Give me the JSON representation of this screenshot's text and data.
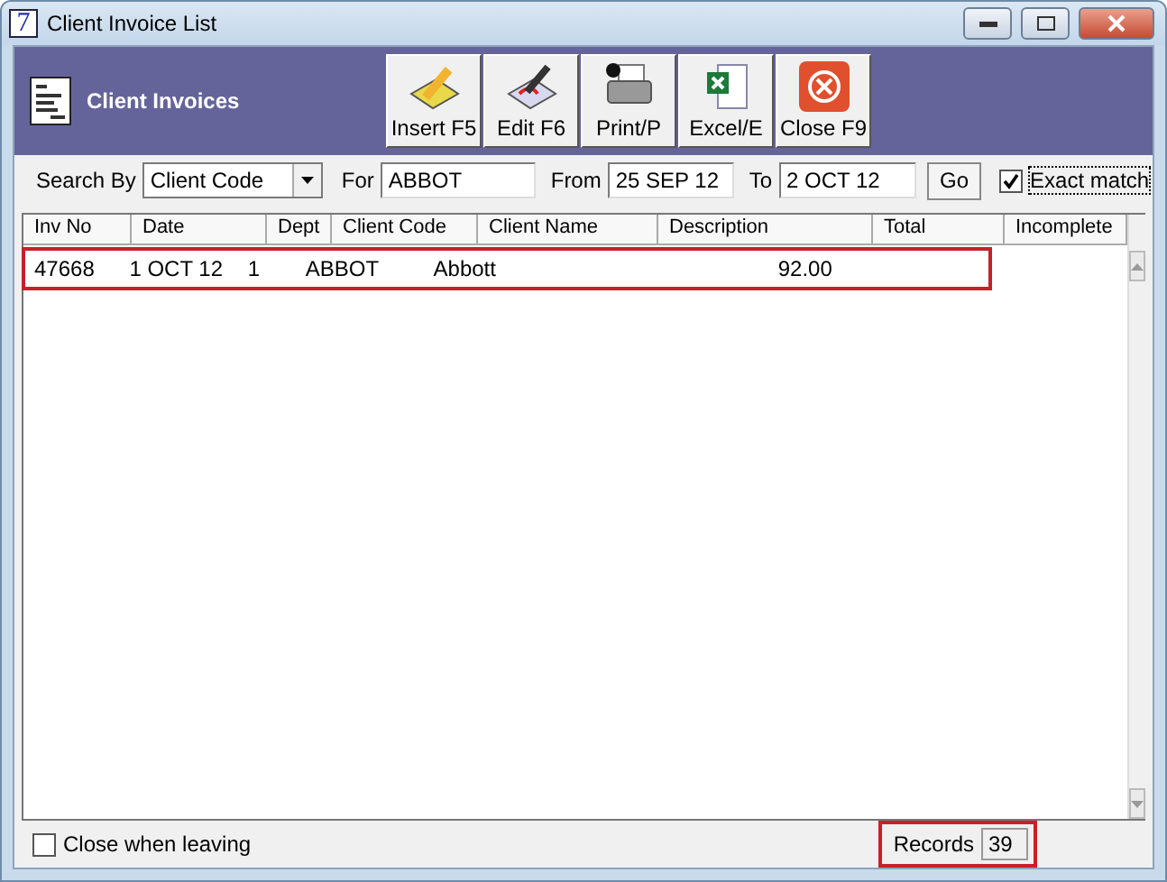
{
  "window": {
    "icon": "7",
    "title": "Client Invoice List"
  },
  "header": {
    "title": "Client Invoices"
  },
  "toolbar": [
    {
      "label": "Insert F5",
      "kind": "insert"
    },
    {
      "label": "Edit F6",
      "kind": "edit"
    },
    {
      "label": "Print/P",
      "kind": "print"
    },
    {
      "label": "Excel/E",
      "kind": "excel"
    },
    {
      "label": "Close F9",
      "kind": "close"
    }
  ],
  "search": {
    "search_by_label": "Search By",
    "search_by": "Client Code",
    "for_label": "For",
    "for": "ABBOT",
    "from_label": "From",
    "from": "25 SEP 12",
    "to_label": "To",
    "to": "2 OCT 12",
    "go": "Go",
    "exact_match": {
      "label": "Exact match",
      "checked": true
    }
  },
  "table": {
    "columns": [
      "Inv No",
      "Date",
      "Dept",
      "Client Code",
      "Client Name",
      "Description",
      "Total",
      "Incomplete"
    ],
    "rows": [
      {
        "cells": [
          "47668",
          "1 OCT 12",
          "1",
          "ABBOT",
          "Abbott",
          "",
          "92.00",
          ""
        ],
        "highlighted": true
      }
    ]
  },
  "footer": {
    "close_when_leaving": {
      "label": "Close when leaving",
      "checked": false
    },
    "records_label": "Records",
    "records": "39",
    "highlighted": true
  }
}
